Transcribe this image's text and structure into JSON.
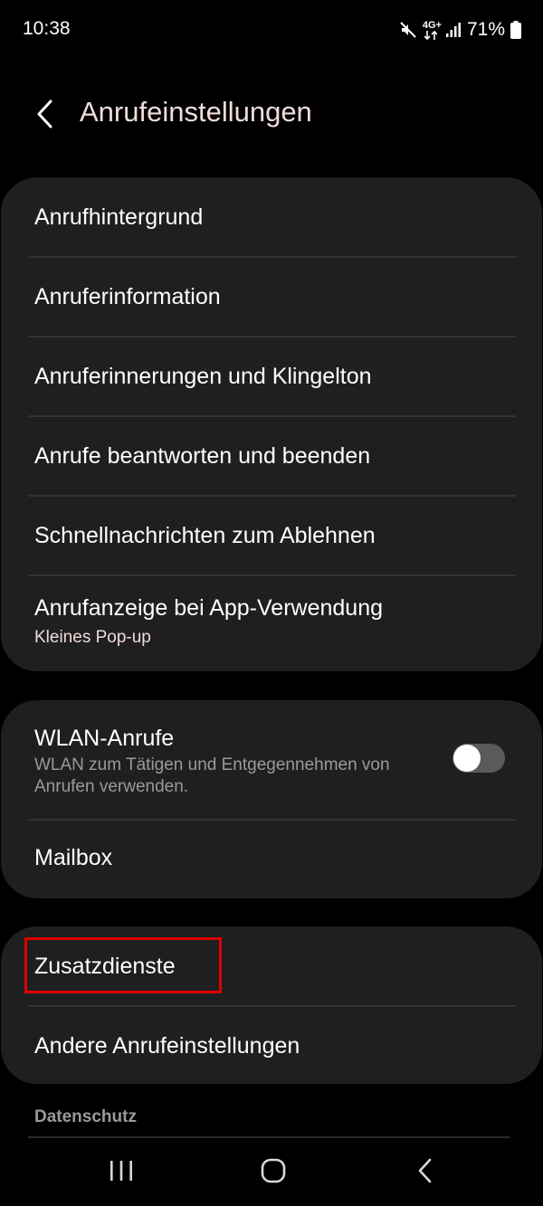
{
  "status_bar": {
    "time": "10:38",
    "network": "4G+",
    "battery": "71%",
    "icons": [
      "mute-icon",
      "network-4g-icon",
      "signal-icon",
      "battery-icon"
    ]
  },
  "header": {
    "title": "Anrufeinstellungen",
    "back_icon": "chevron-left-icon"
  },
  "group1": {
    "items": [
      {
        "title": "Anrufhintergrund"
      },
      {
        "title": "Anruferinformation"
      },
      {
        "title": "Anruferinnerungen und Klingelton"
      },
      {
        "title": "Anrufe beantworten und beenden"
      },
      {
        "title": "Schnellnachrichten zum Ablehnen"
      },
      {
        "title": "Anrufanzeige bei App-Verwendung",
        "subtitle": "Kleines Pop-up"
      }
    ]
  },
  "group2": {
    "wifi_calling": {
      "title": "WLAN-Anrufe",
      "description": "WLAN zum Tätigen und Entgegennehmen von Anrufen verwenden.",
      "enabled": false
    },
    "mailbox": {
      "title": "Mailbox"
    }
  },
  "group3": {
    "items": [
      {
        "title": "Zusatzdienste",
        "highlighted": true
      },
      {
        "title": "Andere Anrufeinstellungen"
      }
    ]
  },
  "section": {
    "privacy_header": "Datenschutz"
  },
  "nav_bar": {
    "icons": [
      "recent-apps-icon",
      "home-icon",
      "back-icon"
    ]
  },
  "colors": {
    "background": "#000000",
    "card": "#1f1f1f",
    "title_accent": "#f1dcdc",
    "highlight": "#e00000",
    "toggle_off": "#5a5a5a"
  }
}
